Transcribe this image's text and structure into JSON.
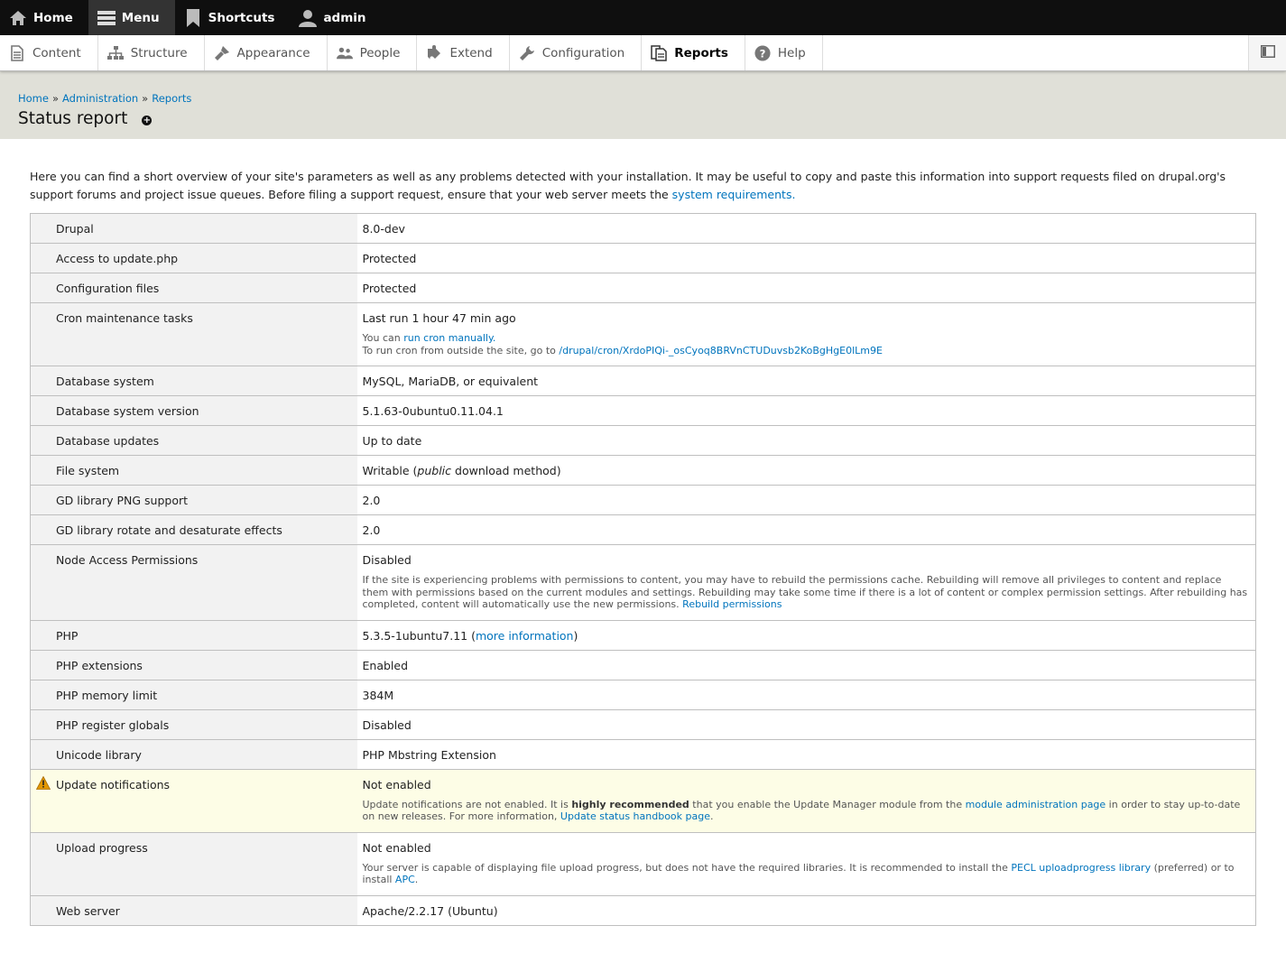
{
  "toolbar": {
    "home": "Home",
    "menu": "Menu",
    "shortcuts": "Shortcuts",
    "user": "admin"
  },
  "tray": {
    "items": [
      {
        "label": "Content",
        "icon": "document-icon"
      },
      {
        "label": "Structure",
        "icon": "sitemap-icon"
      },
      {
        "label": "Appearance",
        "icon": "brush-icon"
      },
      {
        "label": "People",
        "icon": "people-icon"
      },
      {
        "label": "Extend",
        "icon": "puzzle-icon"
      },
      {
        "label": "Configuration",
        "icon": "wrench-icon"
      },
      {
        "label": "Reports",
        "icon": "report-icon"
      },
      {
        "label": "Help",
        "icon": "help-icon"
      }
    ],
    "active": "Reports"
  },
  "breadcrumb": {
    "items": [
      "Home",
      "Administration",
      "Reports"
    ],
    "separator": "»"
  },
  "page_title": "Status report",
  "intro": {
    "text": "Here you can find a short overview of your site's parameters as well as any problems detected with your installation. It may be useful to copy and paste this information into support requests filed on drupal.org's support forums and project issue queues. Before filing a support request, ensure that your web server meets the ",
    "link": "system requirements."
  },
  "rows": {
    "drupal": {
      "label": "Drupal",
      "value": "8.0-dev"
    },
    "update_php": {
      "label": "Access to update.php",
      "value": "Protected"
    },
    "config_files": {
      "label": "Configuration files",
      "value": "Protected"
    },
    "cron": {
      "label": "Cron maintenance tasks",
      "value": "Last run 1 hour 47 min ago",
      "desc1_pre": "You can ",
      "desc1_link": "run cron manually.",
      "desc2_pre": "To run cron from outside the site, go to ",
      "desc2_link": "/drupal/cron/XrdoPIQi-_osCyoq8BRVnCTUDuvsb2KoBgHgE0lLm9E"
    },
    "db_system": {
      "label": "Database system",
      "value": "MySQL, MariaDB, or equivalent"
    },
    "db_version": {
      "label": "Database system version",
      "value": "5.1.63-0ubuntu0.11.04.1"
    },
    "db_updates": {
      "label": "Database updates",
      "value": "Up to date"
    },
    "file_system": {
      "label": "File system",
      "value_pre": "Writable (",
      "value_em": "public",
      "value_post": " download method)"
    },
    "gd_png": {
      "label": "GD library PNG support",
      "value": "2.0"
    },
    "gd_rotate": {
      "label": "GD library rotate and desaturate effects",
      "value": "2.0"
    },
    "node_access": {
      "label": "Node Access Permissions",
      "value": "Disabled",
      "desc": "If the site is experiencing problems with permissions to content, you may have to rebuild the permissions cache. Rebuilding will remove all privileges to content and replace them with permissions based on the current modules and settings. Rebuilding may take some time if there is a lot of content or complex permission settings. After rebuilding has completed, content will automatically use the new permissions. ",
      "desc_link": "Rebuild permissions"
    },
    "php": {
      "label": "PHP",
      "value": "5.3.5-1ubuntu7.11 (",
      "link": "more information",
      "value_post": ")"
    },
    "php_ext": {
      "label": "PHP extensions",
      "value": "Enabled"
    },
    "php_mem": {
      "label": "PHP memory limit",
      "value": "384M"
    },
    "php_globals": {
      "label": "PHP register globals",
      "value": "Disabled"
    },
    "unicode": {
      "label": "Unicode library",
      "value": "PHP Mbstring Extension"
    },
    "update_notif": {
      "label": "Update notifications",
      "value": "Not enabled",
      "desc_pre": "Update notifications are not enabled. It is ",
      "desc_strong": "highly recommended",
      "desc_mid": " that you enable the Update Manager module from the ",
      "desc_link1": "module administration page",
      "desc_mid2": " in order to stay up-to-date on new releases. For more information, ",
      "desc_link2": "Update status handbook page",
      "desc_post": "."
    },
    "upload": {
      "label": "Upload progress",
      "value": "Not enabled",
      "desc_pre": "Your server is capable of displaying file upload progress, but does not have the required libraries. It is recommended to install the ",
      "desc_link1": "PECL uploadprogress library",
      "desc_mid": " (preferred) or to install ",
      "desc_link2": "APC",
      "desc_post": "."
    },
    "web_server": {
      "label": "Web server",
      "value": "Apache/2.2.17 (Ubuntu)"
    }
  },
  "colors": {
    "link": "#0074bd",
    "toolbar_bg": "#0f0f0f",
    "header_bg": "#e0e0d8",
    "warning_bg": "#fdfde6",
    "warning_icon": "#e29700"
  }
}
